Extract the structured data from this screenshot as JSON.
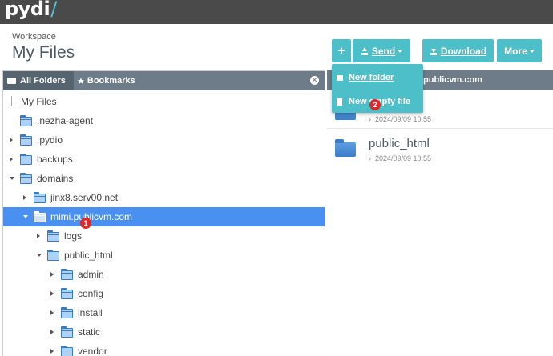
{
  "app": {
    "logo": "pydi",
    "logo_slash": "/"
  },
  "header": {
    "workspace_label": "Workspace",
    "title": "My Files"
  },
  "toolbar": {
    "plus_label": "+",
    "send_label": "Send",
    "download_label": "Download",
    "more_label": "More"
  },
  "send_menu": {
    "items": [
      {
        "label": "New folder",
        "icon": "folder-icon"
      },
      {
        "label": "New empty file",
        "icon": "file-icon"
      }
    ]
  },
  "left_panel": {
    "tabs": [
      {
        "label": "All Folders",
        "icon": "folder-open-icon"
      },
      {
        "label": "Bookmarks",
        "icon": "star-icon"
      }
    ],
    "close_icon": "close-icon"
  },
  "tree": [
    {
      "label": "My Files",
      "state": "root"
    },
    {
      "label": ".nezha-agent",
      "state": "none"
    },
    {
      "label": ".pydio",
      "state": "collapsed"
    },
    {
      "label": "backups",
      "state": "collapsed"
    },
    {
      "label": "domains",
      "state": "expanded"
    },
    {
      "label": "jinx8.serv00.net",
      "state": "collapsed"
    },
    {
      "label": "mimi.publicvm.com",
      "state": "expanded",
      "selected": true
    },
    {
      "label": "logs",
      "state": "collapsed"
    },
    {
      "label": "public_html",
      "state": "expanded"
    },
    {
      "label": "admin",
      "state": "collapsed"
    },
    {
      "label": "config",
      "state": "collapsed"
    },
    {
      "label": "install",
      "state": "collapsed"
    },
    {
      "label": "static",
      "state": "collapsed"
    },
    {
      "label": "vendor",
      "state": "collapsed"
    }
  ],
  "right_panel": {
    "header_partial": "publicvm.com",
    "files": [
      {
        "name": "",
        "date": "2024/09/09 10:55"
      },
      {
        "name": "public_html",
        "date": "2024/09/09 10:55"
      }
    ]
  },
  "badges": {
    "first": "1",
    "second": "2"
  },
  "colors": {
    "accent": "#4dbfc8",
    "selected": "#4a90f0",
    "header": "#6d7c88",
    "topbar": "#4a4a4a",
    "badge": "#d92b2b"
  }
}
